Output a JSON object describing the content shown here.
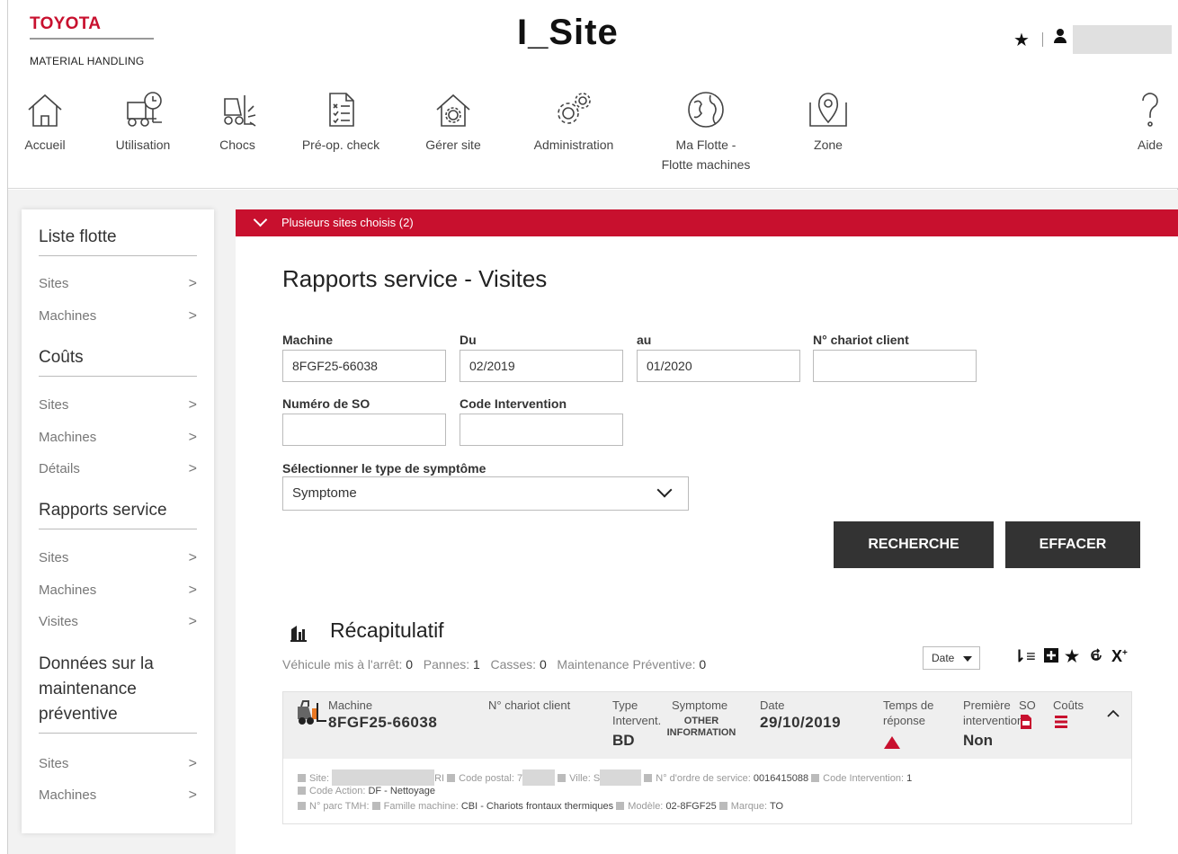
{
  "header": {
    "brand_name": "TOYOTA",
    "brand_sub": "MATERIAL HANDLING",
    "app_title": "I_Site"
  },
  "nav": {
    "items": [
      {
        "label": "Accueil",
        "icon": "home-icon"
      },
      {
        "label": "Utilisation",
        "icon": "forklift-clock-icon"
      },
      {
        "label": "Chocs",
        "icon": "forklift-impact-icon"
      },
      {
        "label": "Pré-op. check",
        "icon": "checklist-icon"
      },
      {
        "label": "Gérer site",
        "icon": "house-gear-icon"
      },
      {
        "label": "Administration",
        "icon": "gears-icon"
      },
      {
        "label": "Ma Flotte -",
        "label2": "Flotte machines",
        "icon": "globe-icon"
      },
      {
        "label": "Zone",
        "icon": "map-pin-icon"
      },
      {
        "label": "Aide",
        "icon": "question-icon"
      }
    ]
  },
  "sidebar": {
    "sections": [
      {
        "title": "Liste flotte",
        "items": [
          "Sites",
          "Machines"
        ]
      },
      {
        "title": "Coûts",
        "items": [
          "Sites",
          "Machines",
          "Détails"
        ]
      },
      {
        "title": "Rapports service",
        "items": [
          "Sites",
          "Machines",
          "Visites"
        ]
      },
      {
        "title_lines": [
          "Données sur la",
          "maintenance",
          "préventive"
        ],
        "items": [
          "Sites",
          "Machines"
        ]
      }
    ]
  },
  "banner": {
    "text": "Plusieurs sites choisis (2)"
  },
  "page": {
    "title": "Rapports service - Visites"
  },
  "form": {
    "machine_label": "Machine",
    "machine_value": "8FGF25-66038",
    "du_label": "Du",
    "du_value": "02/2019",
    "au_label": "au",
    "au_value": "01/2020",
    "chariot_label": "N° chariot client",
    "chariot_value": "",
    "so_label": "Numéro de SO",
    "so_value": "",
    "code_label": "Code Intervention",
    "code_value": "",
    "symptom_label": "Sélectionner le type de symptôme",
    "symptom_value": "Symptome",
    "search_button": "RECHERCHE",
    "clear_button": "EFFACER"
  },
  "recap": {
    "title": "Récapitulatif",
    "stat1_label": "Véhicule mis à l'arrêt:",
    "stat1_value": "0",
    "stat2_label": "Pannes:",
    "stat2_value": "1",
    "stat3_label": "Casses:",
    "stat3_value": "0",
    "stat4_label": "Maintenance Préventive:",
    "stat4_value": "0",
    "sort_value": "Date"
  },
  "card": {
    "machine_label": "Machine",
    "machine_value": "8FGF25-66038",
    "chariot_label": "N° chariot client",
    "type_label_1": "Type",
    "type_label_2": "Intervent.",
    "type_value": "BD",
    "symptom_label": "Symptome",
    "symptom_value_1": "OTHER",
    "symptom_value_2": "INFORMATION",
    "date_label": "Date",
    "date_value": "29/10/2019",
    "response_label_1": "Temps de",
    "response_label_2": "réponse",
    "first_label_1": "Première",
    "first_label_2": "intervention",
    "first_value": "Non",
    "so_label": "SO",
    "costs_label": "Coûts",
    "d_site_label": "Site:",
    "d_site_tail": "RI",
    "d_cp_label": "Code postal:",
    "d_cp_tail": "7",
    "d_ville_label": "Ville:",
    "d_ville_tail": "S",
    "d_order_label": "N° d'ordre de service:",
    "d_order_value": "0016415088",
    "d_code_label": "Code Intervention:",
    "d_code_value": "1",
    "d_action_label": "Code Action:",
    "d_action_value": "DF - Nettoyage",
    "d_parc_label": "N° parc TMH:",
    "d_famille_label": "Famille machine:",
    "d_famille_value": "CBI - Chariots frontaux thermiques",
    "d_modele_label": "Modèle:",
    "d_modele_value": "02-8FGF25",
    "d_marque_label": "Marque:",
    "d_marque_value": "TO"
  },
  "colors": {
    "brand_red": "#c8102e",
    "dark_button": "#333333",
    "alert_red": "#c8102e"
  }
}
